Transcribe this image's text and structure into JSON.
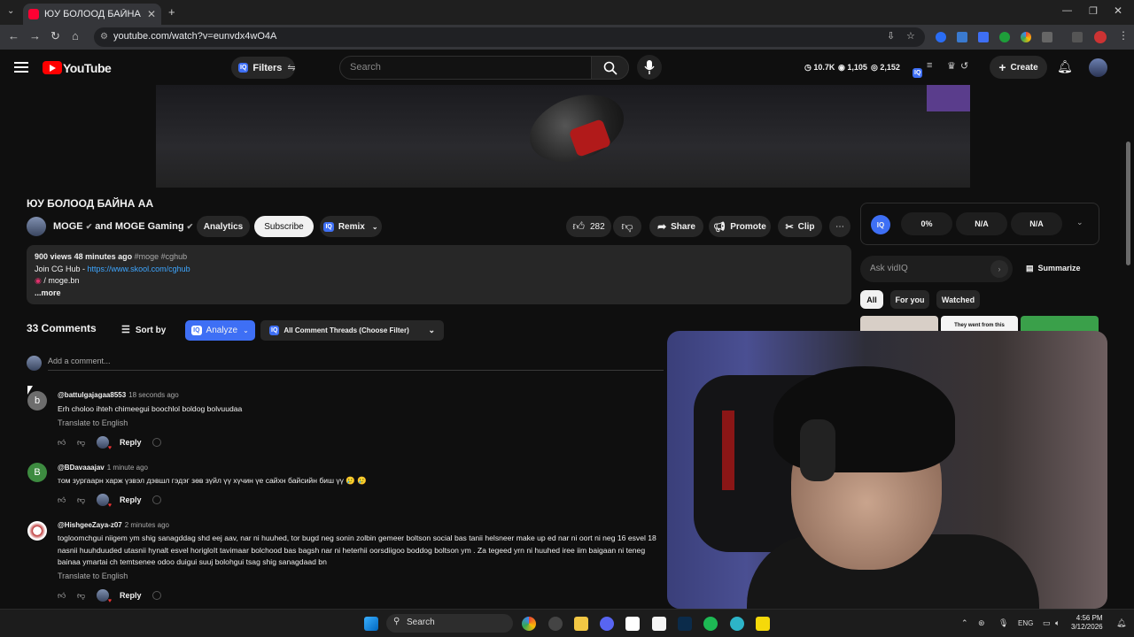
{
  "browser": {
    "tab_title": "ЮУ БОЛООД БАЙНА АА - You",
    "url": "youtube.com/watch?v=eunvdx4wO4A",
    "new_tab_symbol": "+"
  },
  "header": {
    "logo_text": "YouTube",
    "filters_label": "Filters",
    "search_placeholder": "Search",
    "stat_views": "10.7K",
    "stat_eye": "1,105",
    "stat_subs": "2,152",
    "create_label": "Create"
  },
  "video": {
    "title": "ЮУ БОЛООД БАЙНА АА",
    "channel": "MOGE",
    "channel_and": "and",
    "channel2": "MOGE Gaming",
    "analytics_label": "Analytics",
    "subscribe_label": "Subscribe",
    "remix_label": "Remix",
    "likes": "282",
    "share_label": "Share",
    "promote_label": "Promote",
    "clip_label": "Clip"
  },
  "description": {
    "views": "900 views",
    "time": "48 minutes ago",
    "tags": "#moge #cghub",
    "join_text": "Join CG Hub -",
    "join_link": "https://www.skool.com/cghub",
    "insta": "/ moge.bn",
    "more": "...more"
  },
  "sidebar": {
    "iq_label": "IQ",
    "stat1": "0%",
    "stat2": "N/A",
    "stat3": "N/A",
    "ask_placeholder": "Ask vidIQ",
    "summarize_label": "Summarize",
    "chips": [
      "All",
      "For you",
      "Watched"
    ],
    "thumb_text": "They went from this"
  },
  "comments": {
    "count_label": "33 Comments",
    "sort_label": "Sort by",
    "analyze_label": "Analyze",
    "threads_label": "All Comment Threads (Choose Filter)",
    "add_placeholder": "Add a comment...",
    "translate_label": "Translate to English",
    "reply_label": "Reply",
    "items": [
      {
        "initial": "b",
        "user": "@battulgajagaa8553",
        "ago": "18 seconds ago",
        "text": "Erh choloo ihteh chimeegui boochlol boldog bolvuudaa"
      },
      {
        "initial": "B",
        "user": "@BDavaaajav",
        "ago": "1 minute ago",
        "text": "том зургаарн харж үзвэл дэвшл гэдэг зөв зүйл үү хүчин үе сайхн байсийн биш үү 🥲 🥲"
      },
      {
        "initial": "",
        "user": "@HishgeeZaya-z07",
        "ago": "2 minutes ago",
        "text": "togloomchgui niigem ym shig sanagddag shd eej aav, nar ni huuhed, tor bugd neg sonin zolbin gemeer boltson social bas tanii helsneer make up ed nar ni oort ni neg 16 esvel 18 nasnii huuhduuded utasnii hynalt esvel horigloIt tavimaar bolchood bas bagsh nar ni heterhii oorsdiigoo boddog boltson ym . Za tegeed yrn ni huuhed iree iim baigaan ni teneg bainaa ymartai ch temtsenee odoo duigui suuj bolohgui tsag shig sanagdaad bn"
      }
    ]
  },
  "taskbar": {
    "search_label": "Search",
    "lang": "ENG",
    "time": "4:56 PM",
    "date": "3/12/2026"
  },
  "colors": {
    "accent_blue": "#3e6ff5",
    "youtube_red": "#ff0000",
    "link": "#3ea6ff"
  }
}
